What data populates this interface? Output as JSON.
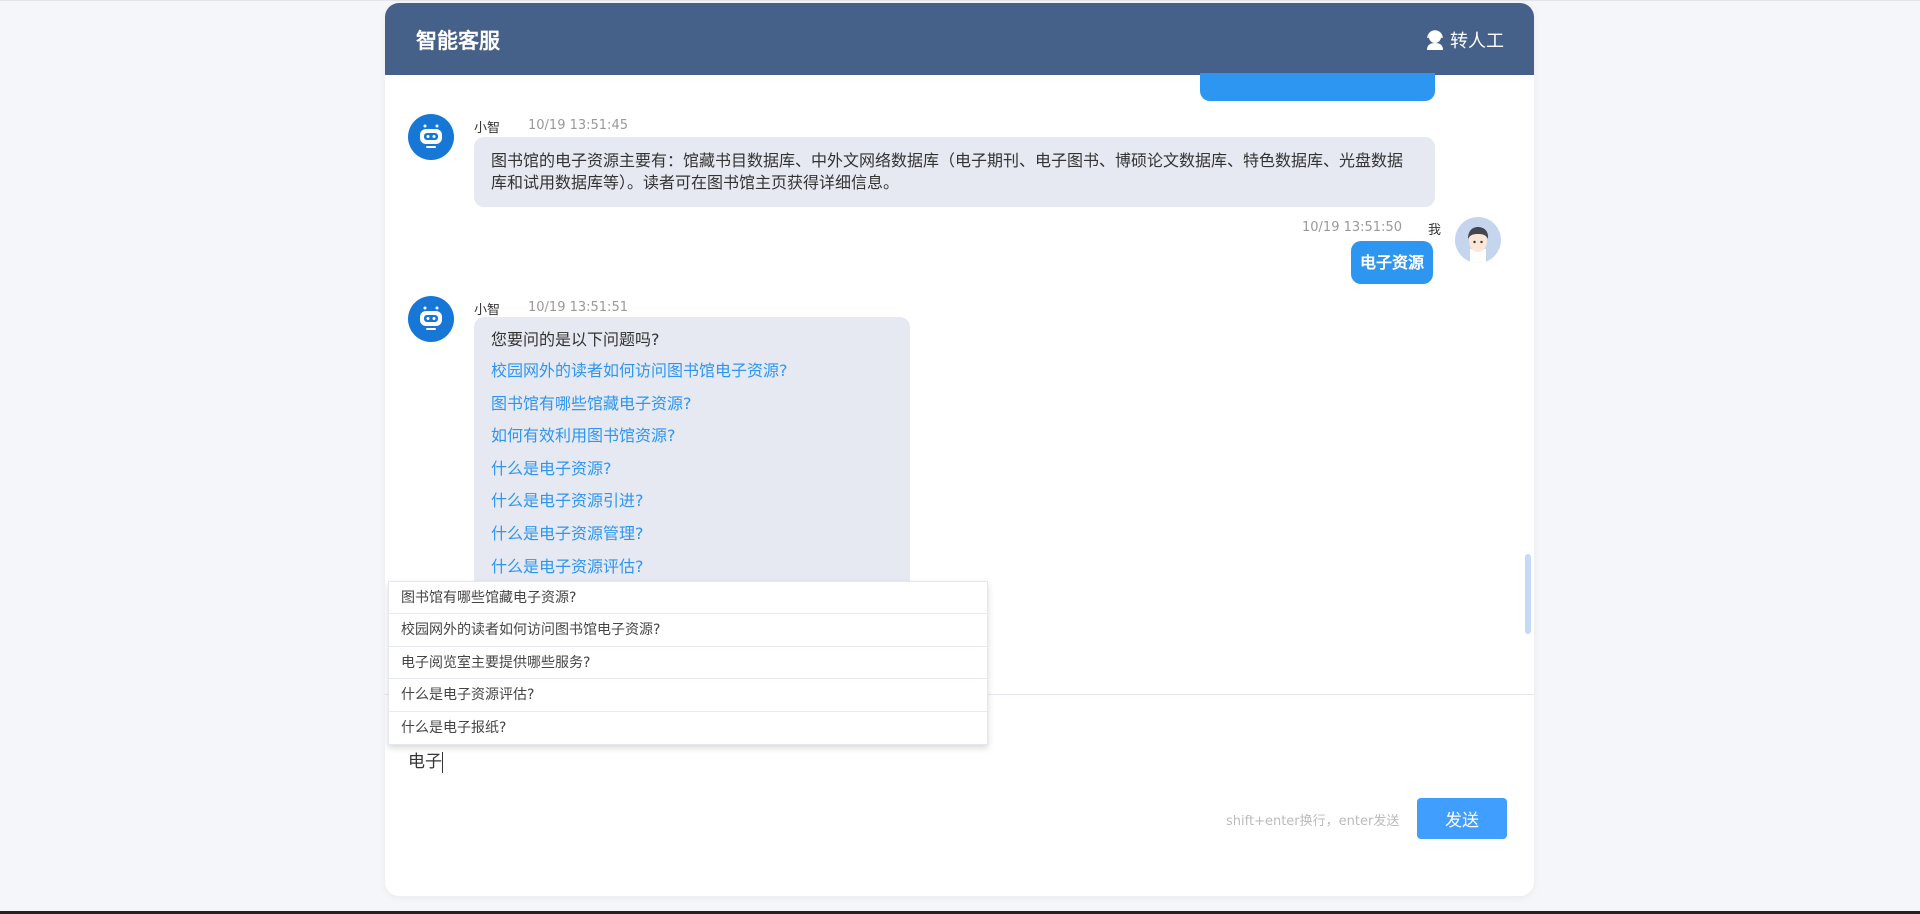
{
  "header": {
    "title": "智能客服",
    "transfer_label": "转人工"
  },
  "messages": [
    {
      "sender": "小智",
      "time": "10/19 13:51:45",
      "text": "图书馆的电子资源主要有：馆藏书目数据库、中外文网络数据库（电子期刊、电子图书、博硕论文数据库、特色数据库、光盘数据库和试用数据库等）。读者可在图书馆主页获得详细信息。"
    },
    {
      "sender": "我",
      "time": "10/19 13:51:50",
      "text": "电子资源"
    },
    {
      "sender": "小智",
      "time": "10/19 13:51:51",
      "intro": "您要问的是以下问题吗?",
      "questions": [
        "校园网外的读者如何访问图书馆电子资源?",
        "图书馆有哪些馆藏电子资源?",
        "如何有效利用图书馆资源?",
        "什么是电子资源?",
        "什么是电子资源引进?",
        "什么是电子资源管理?",
        "什么是电子资源评估?"
      ]
    }
  ],
  "suggestions": [
    "图书馆有哪些馆藏电子资源?",
    "校园网外的读者如何访问图书馆电子资源?",
    "电子阅览室主要提供哪些服务?",
    "什么是电子资源评估?",
    "什么是电子报纸?"
  ],
  "input": {
    "value": "电子",
    "hint": "shift+enter换行，enter发送",
    "send_label": "发送"
  },
  "colors": {
    "header": "#456089",
    "accent": "#409eff",
    "user_bubble": "#2d96f0",
    "bot_bubble": "#e6e9f1"
  }
}
